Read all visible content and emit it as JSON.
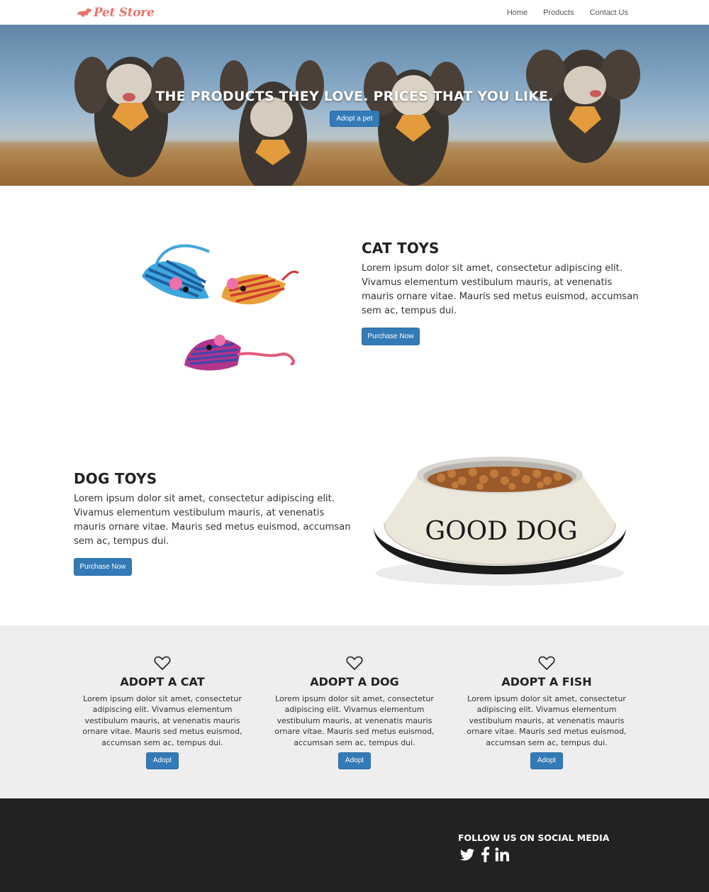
{
  "brand": {
    "name": "Pet Store",
    "color": "#e8756a"
  },
  "nav": {
    "items": [
      {
        "label": "Home"
      },
      {
        "label": "Products"
      },
      {
        "label": "Contact Us"
      }
    ]
  },
  "hero": {
    "title": "THE PRODUCTS THEY LOVE. PRICES THAT YOU LIKE.",
    "button_label": "Adopt a pet"
  },
  "features": [
    {
      "title": "CAT TOYS",
      "text": "Lorem ipsum dolor sit amet, consectetur adipiscing elit. Vivamus elementum vestibulum mauris, at venenatis mauris ornare vitae. Mauris sed metus euismod, accumsan sem ac, tempus dui.",
      "button_label": "Purchase Now"
    },
    {
      "title": "DOG TOYS",
      "text": "Lorem ipsum dolor sit amet, consectetur adipiscing elit. Vivamus elementum vestibulum mauris, at venenatis mauris ornare vitae. Mauris sed metus euismod, accumsan sem ac, tempus dui.",
      "button_label": "Purchase Now",
      "image_text": "GOOD DOG"
    }
  ],
  "adopt": [
    {
      "icon": "heart-icon",
      "title": "ADOPT A CAT",
      "text": "Lorem ipsum dolor sit amet, consectetur adipiscing elit. Vivamus elementum vestibulum mauris, at venenatis mauris ornare vitae. Mauris sed metus euismod, accumsan sem ac, tempus dui.",
      "button_label": "Adopt"
    },
    {
      "icon": "heart-icon",
      "title": "ADOPT A DOG",
      "text": "Lorem ipsum dolor sit amet, consectetur adipiscing elit. Vivamus elementum vestibulum mauris, at venenatis mauris ornare vitae. Mauris sed metus euismod, accumsan sem ac, tempus dui.",
      "button_label": "Adopt"
    },
    {
      "icon": "heart-icon",
      "title": "ADOPT A FISH",
      "text": "Lorem ipsum dolor sit amet, consectetur adipiscing elit. Vivamus elementum vestibulum mauris, at venenatis mauris ornare vitae. Mauris sed metus euismod, accumsan sem ac, tempus dui.",
      "button_label": "Adopt"
    }
  ],
  "footer": {
    "heading": "FOLLOW US ON SOCIAL MEDIA",
    "social": [
      "twitter-icon",
      "facebook-icon",
      "linkedin-icon"
    ]
  },
  "colors": {
    "primary_button": "#337ab7",
    "adopt_background": "#eeeeee",
    "footer_background": "#222222"
  }
}
